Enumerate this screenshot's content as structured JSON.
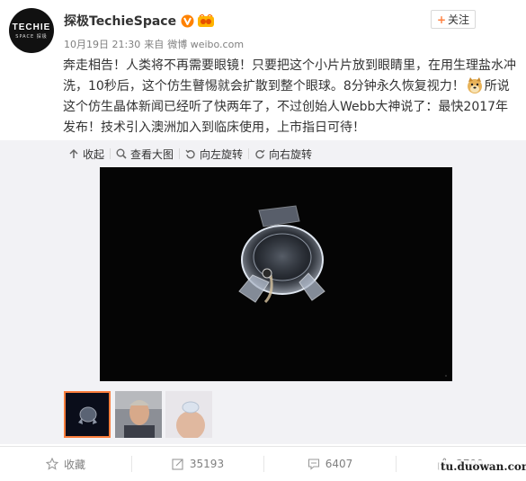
{
  "user": {
    "avatar_brand": "TECHIE",
    "avatar_sub": "SPACE 探极",
    "name": "探极TechieSpace",
    "follow_label": "关注"
  },
  "meta": {
    "date": "10月19日 21:30",
    "source_prefix": "来自",
    "source": "微博 weibo.com"
  },
  "post": {
    "text_part1": "奔走相告！人类将不再需要眼镜！只要把这个小片片放到眼睛里，在用生理盐水冲洗，10秒后，这个仿生瞽惕就会扩散到整个眼球。8分钟永久恢复视力！",
    "text_part2": "所说这个仿生晶体新闻已经听了快两年了，不过创始人Webb大神说了：最快2017年发布！技术引入澳洲加入到临床使用，上市指日可待！"
  },
  "toolbar": {
    "collapse": "收起",
    "view_large": "查看大图",
    "rotate_left": "向左旋转",
    "rotate_right": "向右旋转"
  },
  "actions": {
    "favorite": "收藏",
    "reposts": "35193",
    "comments": "6407",
    "likes": "3799"
  },
  "watermark": "tu.duowan.com",
  "colors": {
    "accent_orange": "#fa7d3c",
    "verified_orange": "#ff8200",
    "toolbar_bg": "#f2f2f5"
  }
}
